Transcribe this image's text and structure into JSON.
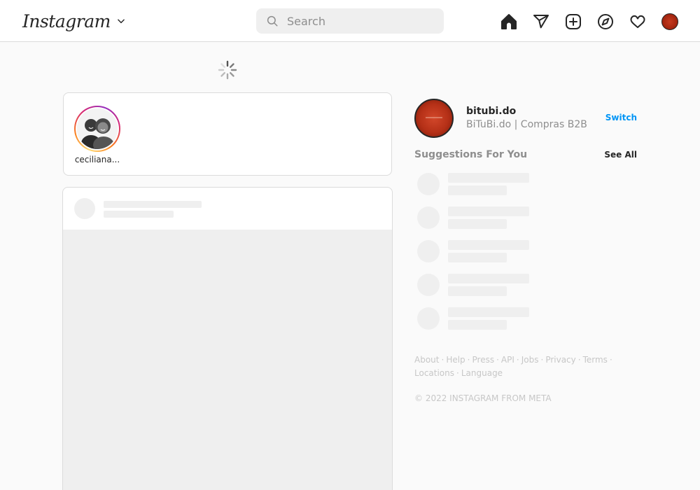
{
  "header": {
    "logo_text": "Instagram",
    "search_placeholder": "Search",
    "nav_icons": [
      "home-icon",
      "direct-messages-icon",
      "new-post-icon",
      "explore-icon",
      "activity-icon",
      "profile-avatar"
    ]
  },
  "stories": [
    {
      "username": "ceciliana..."
    }
  ],
  "profile": {
    "username": "bitubi.do",
    "full_name": "BiTuBi.do | Compras B2B",
    "switch_label": "Switch"
  },
  "suggestions": {
    "title": "Suggestions For You",
    "see_all_label": "See All"
  },
  "footer": {
    "links": [
      "About",
      "Help",
      "Press",
      "API",
      "Jobs",
      "Privacy",
      "Terms",
      "Locations",
      "Language"
    ],
    "copyright": "© 2022 INSTAGRAM FROM META"
  },
  "colors": {
    "link_blue": "#0095f6",
    "skeleton": "#efefef",
    "border": "#dbdbdb",
    "muted_text": "#8e8e8e"
  }
}
